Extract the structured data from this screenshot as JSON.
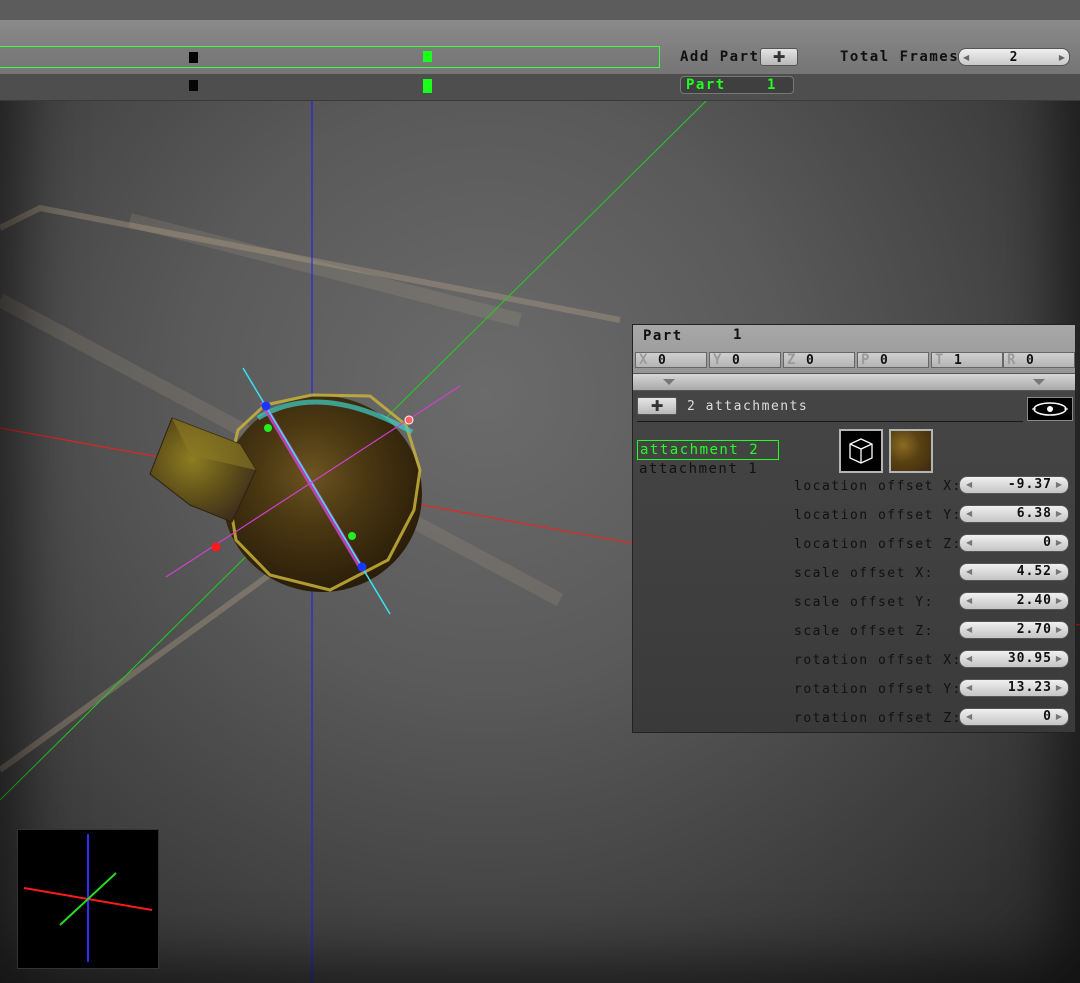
{
  "timeline": {
    "add_part_label": "Add Part",
    "total_frames_label": "Total Frames:",
    "total_frames_value": "2",
    "part_label": "Part",
    "part_value": "1"
  },
  "part_panel": {
    "title": "Part",
    "number": "1",
    "coords": [
      {
        "axis": "X",
        "value": "0"
      },
      {
        "axis": "Y",
        "value": "0"
      },
      {
        "axis": "Z",
        "value": "0"
      },
      {
        "axis": "P",
        "value": "0"
      },
      {
        "axis": "T",
        "value": "1"
      },
      {
        "axis": "R",
        "value": "0"
      }
    ]
  },
  "attachments": {
    "count_label": "2 attachments",
    "items": [
      "attachment 2",
      "attachment 1"
    ],
    "selected": "attachment 2"
  },
  "properties": [
    {
      "label": "location offset X:",
      "value": "-9.37"
    },
    {
      "label": "location offset Y:",
      "value": "6.38"
    },
    {
      "label": "location offset Z:",
      "value": "0"
    },
    {
      "label": "scale offset X:",
      "value": "4.52"
    },
    {
      "label": "scale offset Y:",
      "value": "2.40"
    },
    {
      "label": "scale offset Z:",
      "value": "2.70"
    },
    {
      "label": "rotation offset X:",
      "value": "30.95"
    },
    {
      "label": "rotation offset Y:",
      "value": "13.23"
    },
    {
      "label": "rotation offset Z:",
      "value": "0"
    }
  ],
  "colors": {
    "accent_green": "#22ff22",
    "axis_x": "#ff2020",
    "axis_y": "#22dd22",
    "axis_z": "#2a2aff"
  },
  "icons": [
    "plus-icon",
    "cube-icon",
    "texture-icon",
    "eye-icon",
    "spinner-left-arrow-icon",
    "spinner-right-arrow-icon",
    "collapse-arrow-icon"
  ]
}
